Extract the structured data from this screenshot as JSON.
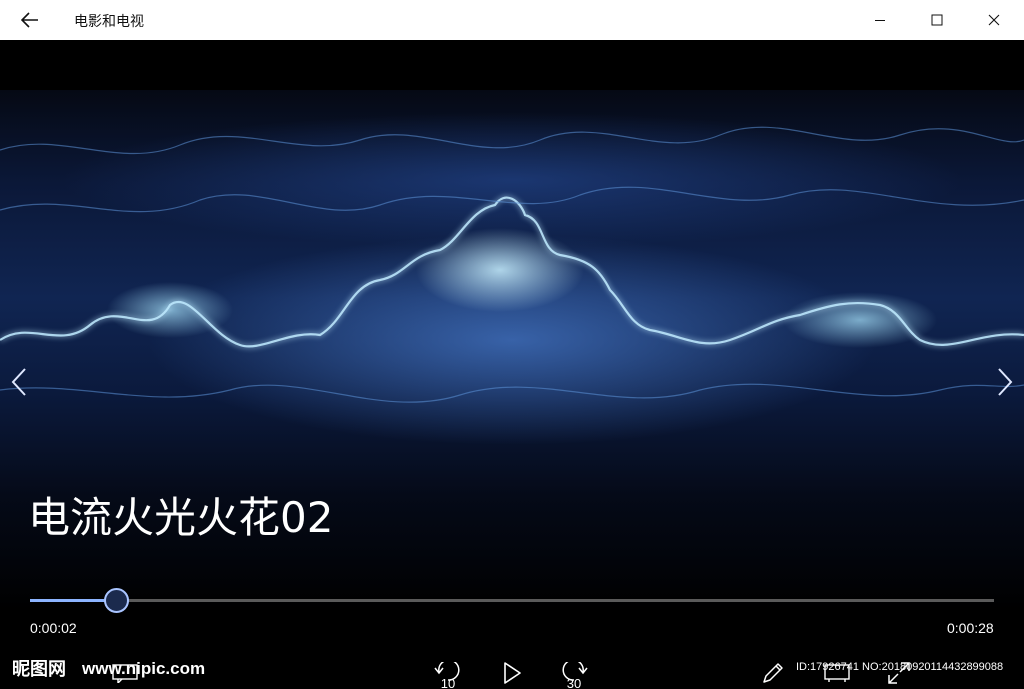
{
  "window": {
    "title": "电影和电视",
    "back_icon": "back-arrow-icon",
    "minimize_icon": "minimize-icon",
    "maximize_icon": "maximize-icon",
    "close_icon": "close-icon"
  },
  "player": {
    "video_title": "电流火光火花02",
    "current_time": "0:00:02",
    "total_time": "0:00:28",
    "progress": 0.09,
    "skip_back_seconds": "10",
    "skip_forward_seconds": "30"
  },
  "watermark": {
    "logo": "昵图网",
    "site": "www.nipic.com",
    "id_text": "ID:17926741 NO:20180920114432899088"
  },
  "colors": {
    "titlebar_bg": "#ffffff",
    "accent": "#8cb4ff",
    "track": "#5a5a5a"
  }
}
